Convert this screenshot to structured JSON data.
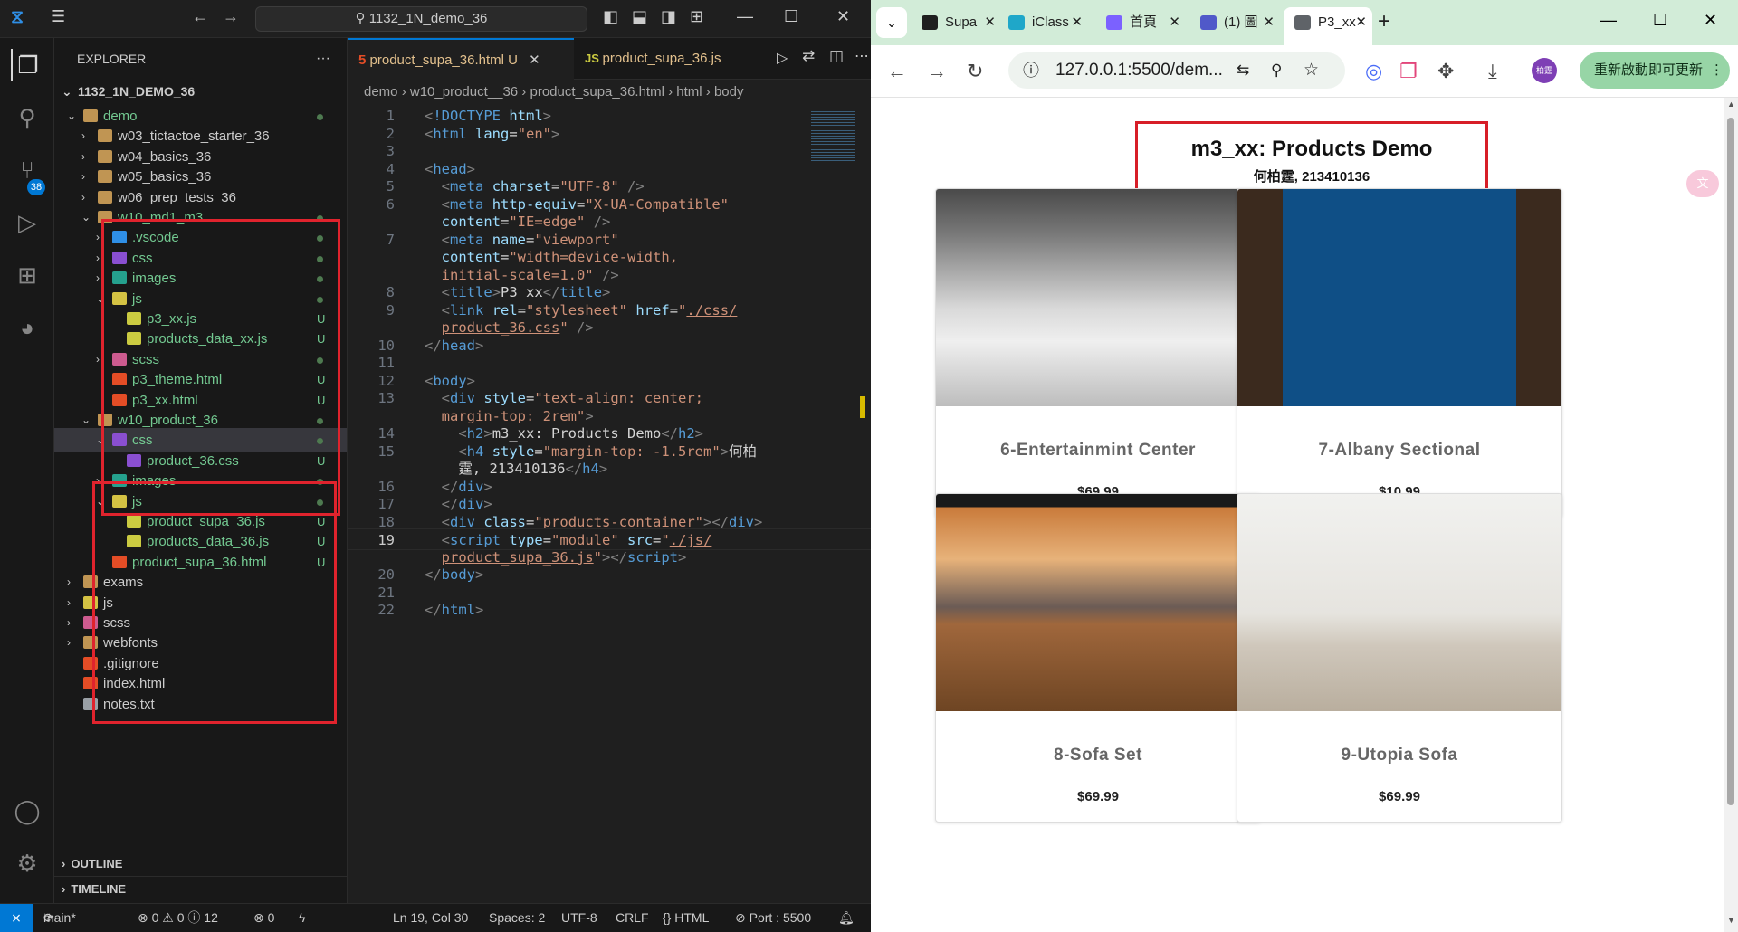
{
  "vscode": {
    "command_center": "1132_1N_demo_36",
    "explorer_title": "EXPLORER",
    "explorer_more": "···",
    "root": "1132_1N_DEMO_36",
    "tree": [
      {
        "label": "demo",
        "kind": "folder-open",
        "indent": 1,
        "status": "dot"
      },
      {
        "label": "w03_tictactoe_starter_36",
        "kind": "folder",
        "indent": 2,
        "status": ""
      },
      {
        "label": "w04_basics_36",
        "kind": "folder",
        "indent": 2,
        "status": ""
      },
      {
        "label": "w05_basics_36",
        "kind": "folder",
        "indent": 2,
        "status": ""
      },
      {
        "label": "w06_prep_tests_36",
        "kind": "folder",
        "indent": 2,
        "status": ""
      },
      {
        "label": "w10_md1_m3",
        "kind": "folder-open",
        "indent": 2,
        "status": "dot"
      },
      {
        "label": ".vscode",
        "kind": "vscode",
        "indent": 3,
        "status": "dot"
      },
      {
        "label": "css",
        "kind": "css-folder",
        "indent": 3,
        "status": "dot"
      },
      {
        "label": "images",
        "kind": "img-folder",
        "indent": 3,
        "status": "dot"
      },
      {
        "label": "js",
        "kind": "js-folder-open",
        "indent": 3,
        "status": "dot"
      },
      {
        "label": "p3_xx.js",
        "kind": "js",
        "indent": 4,
        "status": "U"
      },
      {
        "label": "products_data_xx.js",
        "kind": "js",
        "indent": 4,
        "status": "U"
      },
      {
        "label": "scss",
        "kind": "scss-folder",
        "indent": 3,
        "status": "dot"
      },
      {
        "label": "p3_theme.html",
        "kind": "html",
        "indent": 3,
        "status": "U"
      },
      {
        "label": "p3_xx.html",
        "kind": "html",
        "indent": 3,
        "status": "U"
      },
      {
        "label": "w10_product_36",
        "kind": "folder-open",
        "indent": 2,
        "status": "dot"
      },
      {
        "label": "css",
        "kind": "css-folder-open",
        "indent": 3,
        "status": "dot",
        "selected": true
      },
      {
        "label": "product_36.css",
        "kind": "cssfile",
        "indent": 4,
        "status": "U"
      },
      {
        "label": "images",
        "kind": "img-folder",
        "indent": 3,
        "status": "dot"
      },
      {
        "label": "js",
        "kind": "js-folder-open",
        "indent": 3,
        "status": "dot"
      },
      {
        "label": "product_supa_36.js",
        "kind": "js",
        "indent": 4,
        "status": "U"
      },
      {
        "label": "products_data_36.js",
        "kind": "js",
        "indent": 4,
        "status": "U"
      },
      {
        "label": "product_supa_36.html",
        "kind": "html",
        "indent": 3,
        "status": "U"
      },
      {
        "label": "exams",
        "kind": "folder",
        "indent": 1,
        "status": ""
      },
      {
        "label": "js",
        "kind": "js-folder",
        "indent": 1,
        "status": ""
      },
      {
        "label": "scss",
        "kind": "scss-folder",
        "indent": 1,
        "status": ""
      },
      {
        "label": "webfonts",
        "kind": "folder",
        "indent": 1,
        "status": ""
      },
      {
        "label": ".gitignore",
        "kind": "git",
        "indent": 1,
        "status": ""
      },
      {
        "label": "index.html",
        "kind": "html",
        "indent": 1,
        "status": ""
      },
      {
        "label": "notes.txt",
        "kind": "txt",
        "indent": 1,
        "status": ""
      }
    ],
    "outline": "OUTLINE",
    "timeline": "TIMELINE",
    "tabs": [
      {
        "label": "product_supa_36.html",
        "status": "U",
        "active": true,
        "icon": "html"
      },
      {
        "label": "product_supa_36.js",
        "status": "",
        "active": false,
        "icon": "js"
      }
    ],
    "breadcrumb": [
      "demo",
      "w10_product__36",
      "product_supa_36.html",
      "html",
      "body"
    ],
    "code": [
      {
        "n": "1",
        "html": "<span class='p'>&lt;</span><span class='t'>!DOCTYPE</span> <span class='a'>html</span><span class='p'>&gt;</span>"
      },
      {
        "n": "2",
        "html": "<span class='p'>&lt;</span><span class='t'>html</span> <span class='a'>lang</span><span class='w'>=</span><span class='s'>\"en\"</span><span class='p'>&gt;</span>"
      },
      {
        "n": "3",
        "html": ""
      },
      {
        "n": "4",
        "html": "<span class='p'>&lt;</span><span class='t'>head</span><span class='p'>&gt;</span>"
      },
      {
        "n": "5",
        "html": "  <span class='p'>&lt;</span><span class='t'>meta</span> <span class='a'>charset</span><span class='w'>=</span><span class='s'>\"UTF-8\"</span> <span class='p'>/&gt;</span>"
      },
      {
        "n": "6",
        "html": "  <span class='p'>&lt;</span><span class='t'>meta</span> <span class='a'>http-equiv</span><span class='w'>=</span><span class='s'>\"X-UA-Compatible\"</span>"
      },
      {
        "n": "",
        "html": "  <span class='a'>content</span><span class='w'>=</span><span class='s'>\"IE=edge\"</span> <span class='p'>/&gt;</span>"
      },
      {
        "n": "7",
        "html": "  <span class='p'>&lt;</span><span class='t'>meta</span> <span class='a'>name</span><span class='w'>=</span><span class='s'>\"viewport\"</span>"
      },
      {
        "n": "",
        "html": "  <span class='a'>content</span><span class='w'>=</span><span class='s'>\"width=device-width,</span>"
      },
      {
        "n": "",
        "html": "  <span class='s'>initial-scale=1.0\"</span> <span class='p'>/&gt;</span>"
      },
      {
        "n": "8",
        "html": "  <span class='p'>&lt;</span><span class='t'>title</span><span class='p'>&gt;</span><span class='w'>P3_xx</span><span class='p'>&lt;/</span><span class='t'>title</span><span class='p'>&gt;</span>"
      },
      {
        "n": "9",
        "html": "  <span class='p'>&lt;</span><span class='t'>link</span> <span class='a'>rel</span><span class='w'>=</span><span class='s'>\"stylesheet\"</span> <span class='a'>href</span><span class='w'>=</span><span class='s'>\"<span class='u'>./css/</span></span>"
      },
      {
        "n": "",
        "html": "  <span class='s u'>product_36.css</span><span class='s'>\"</span> <span class='p'>/&gt;</span>"
      },
      {
        "n": "10",
        "html": "<span class='p'>&lt;/</span><span class='t'>head</span><span class='p'>&gt;</span>"
      },
      {
        "n": "11",
        "html": ""
      },
      {
        "n": "12",
        "html": "<span class='p'>&lt;</span><span class='t'>body</span><span class='p'>&gt;</span>"
      },
      {
        "n": "13",
        "html": "  <span class='p'>&lt;</span><span class='t'>div</span> <span class='a'>style</span><span class='w'>=</span><span class='s'>\"text-align: center;</span>"
      },
      {
        "n": "",
        "html": "  <span class='s'>margin-top: 2rem\"</span><span class='p'>&gt;</span>"
      },
      {
        "n": "14",
        "html": "    <span class='p'>&lt;</span><span class='t'>h2</span><span class='p'>&gt;</span><span class='w'>m3_xx: Products Demo</span><span class='p'>&lt;/</span><span class='t'>h2</span><span class='p'>&gt;</span>"
      },
      {
        "n": "15",
        "html": "    <span class='p'>&lt;</span><span class='t'>h4</span> <span class='a'>style</span><span class='w'>=</span><span class='s'>\"margin-top: -1.5rem\"</span><span class='p'>&gt;</span><span class='w'>何柏</span>"
      },
      {
        "n": "",
        "html": "    <span class='w'>霆, 213410136</span><span class='p'>&lt;/</span><span class='t'>h4</span><span class='p'>&gt;</span>"
      },
      {
        "n": "16",
        "html": "  <span class='p'>&lt;/</span><span class='t'>div</span><span class='p'>&gt;</span>"
      },
      {
        "n": "17",
        "html": "  <span class='p'>&lt;/</span><span class='t'>div</span><span class='p'>&gt;</span>"
      },
      {
        "n": "18",
        "html": "  <span class='p'>&lt;</span><span class='t'>div</span> <span class='a'>class</span><span class='w'>=</span><span class='s'>\"products-container\"</span><span class='p'>&gt;&lt;/</span><span class='t'>div</span><span class='p'>&gt;</span>"
      },
      {
        "n": "19",
        "html": "  <span class='p'>&lt;</span><span class='t'>script</span> <span class='a'>type</span><span class='w'>=</span><span class='s'>\"module\"</span> <span class='a'>src</span><span class='w'>=</span><span class='s'>\"<span class='u'>./js/</span></span>",
        "cur": true
      },
      {
        "n": "",
        "html": "  <span class='s u'>product_supa_36.js</span><span class='s'>\"</span><span class='p'>&gt;&lt;/</span><span class='t'>script</span><span class='p'>&gt;</span>"
      },
      {
        "n": "20",
        "html": "<span class='p'>&lt;/</span><span class='t'>body</span><span class='p'>&gt;</span>"
      },
      {
        "n": "21",
        "html": ""
      },
      {
        "n": "22",
        "html": "<span class='p'>&lt;/</span><span class='t'>html</span><span class='p'>&gt;</span>"
      }
    ],
    "status": {
      "branch": "main*",
      "problems": "⊗ 0 ⚠ 0 ⓘ 12",
      "ports": "⊗ 0",
      "cursor": "Ln 19, Col 30",
      "spaces": "Spaces: 2",
      "encoding": "UTF-8",
      "eol": "CRLF",
      "lang": "{} HTML",
      "port": "⊘ Port : 5500"
    },
    "badge": "38"
  },
  "browser": {
    "tabs": [
      {
        "label": "Supa",
        "color": "#1f1f1f"
      },
      {
        "label": "iClass",
        "color": "#1fa7c9"
      },
      {
        "label": "首頁",
        "color": "#7b61ff"
      },
      {
        "label": "(1) 圖",
        "color": "#5059c9"
      },
      {
        "label": "P3_xx",
        "color": "#5f6368",
        "active": true
      }
    ],
    "new_tab": "+",
    "url": "127.0.0.1:5500/dem...",
    "update_button": "重新啟動即可更新",
    "profile": "柏霆",
    "page": {
      "title": "m3_xx: Products Demo",
      "subtitle": "何柏霆, 213410136",
      "products": [
        {
          "name": "6-Entertainmint Center",
          "price": "$69.99",
          "scene": "tv"
        },
        {
          "name": "7-Albany Sectional",
          "price": "$10.99",
          "scene": "blue"
        },
        {
          "name": "8-Sofa Set",
          "price": "$69.99",
          "scene": "bed"
        },
        {
          "name": "9-Utopia Sofa",
          "price": "$69.99",
          "scene": "sofa"
        }
      ]
    }
  }
}
